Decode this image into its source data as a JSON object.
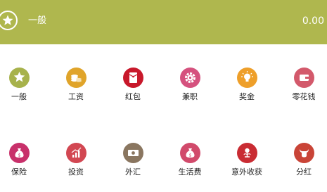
{
  "header": {
    "category": "一般",
    "amount": "0.00",
    "background": "#afb74e",
    "icon": "star-icon"
  },
  "categories": [
    {
      "label": "一般",
      "icon": "star-icon",
      "color": "#a7b24b"
    },
    {
      "label": "工资",
      "icon": "coins-icon",
      "color": "#e0a42a"
    },
    {
      "label": "红包",
      "icon": "red-envelope-icon",
      "color": "#c8182b"
    },
    {
      "label": "兼职",
      "icon": "gear-icon",
      "color": "#d5517e"
    },
    {
      "label": "奖金",
      "icon": "lightbulb-icon",
      "color": "#ee9f2a"
    },
    {
      "label": "零花钱",
      "icon": "wallet-icon",
      "color": "#d3596b"
    },
    {
      "label": "保险",
      "icon": "money-bag-icon",
      "color": "#c8306a"
    },
    {
      "label": "投资",
      "icon": "growth-chart-icon",
      "color": "#d24752"
    },
    {
      "label": "外汇",
      "icon": "cash-icon",
      "color": "#8a7660"
    },
    {
      "label": "生活费",
      "icon": "money-bag-icon",
      "color": "#d14a6b"
    },
    {
      "label": "意外收获",
      "icon": "plant-coin-icon",
      "color": "#c92c33"
    },
    {
      "label": "分红",
      "icon": "bull-icon",
      "color": "#c94437"
    }
  ]
}
